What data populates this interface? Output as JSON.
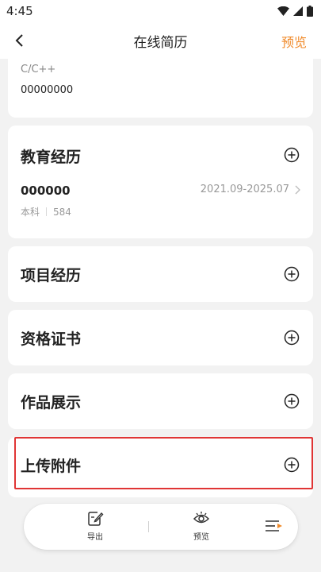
{
  "status_bar": {
    "time": "4:45"
  },
  "header": {
    "title": "在线简历",
    "right_action": "预览"
  },
  "skills": {
    "name": "C/C++",
    "value": "00000000"
  },
  "education": {
    "title": "教育经历",
    "school": "000000",
    "date": "2021.09-2025.07",
    "degree": "本科",
    "major": "584"
  },
  "sections": {
    "project": "项目经历",
    "certificate": "资格证书",
    "works": "作品展示",
    "upload": "上传附件"
  },
  "bottom_bar": {
    "export_label": "导出",
    "preview_label": "预览"
  },
  "colors": {
    "accent": "#f08a2a",
    "highlight": "#e03535"
  }
}
